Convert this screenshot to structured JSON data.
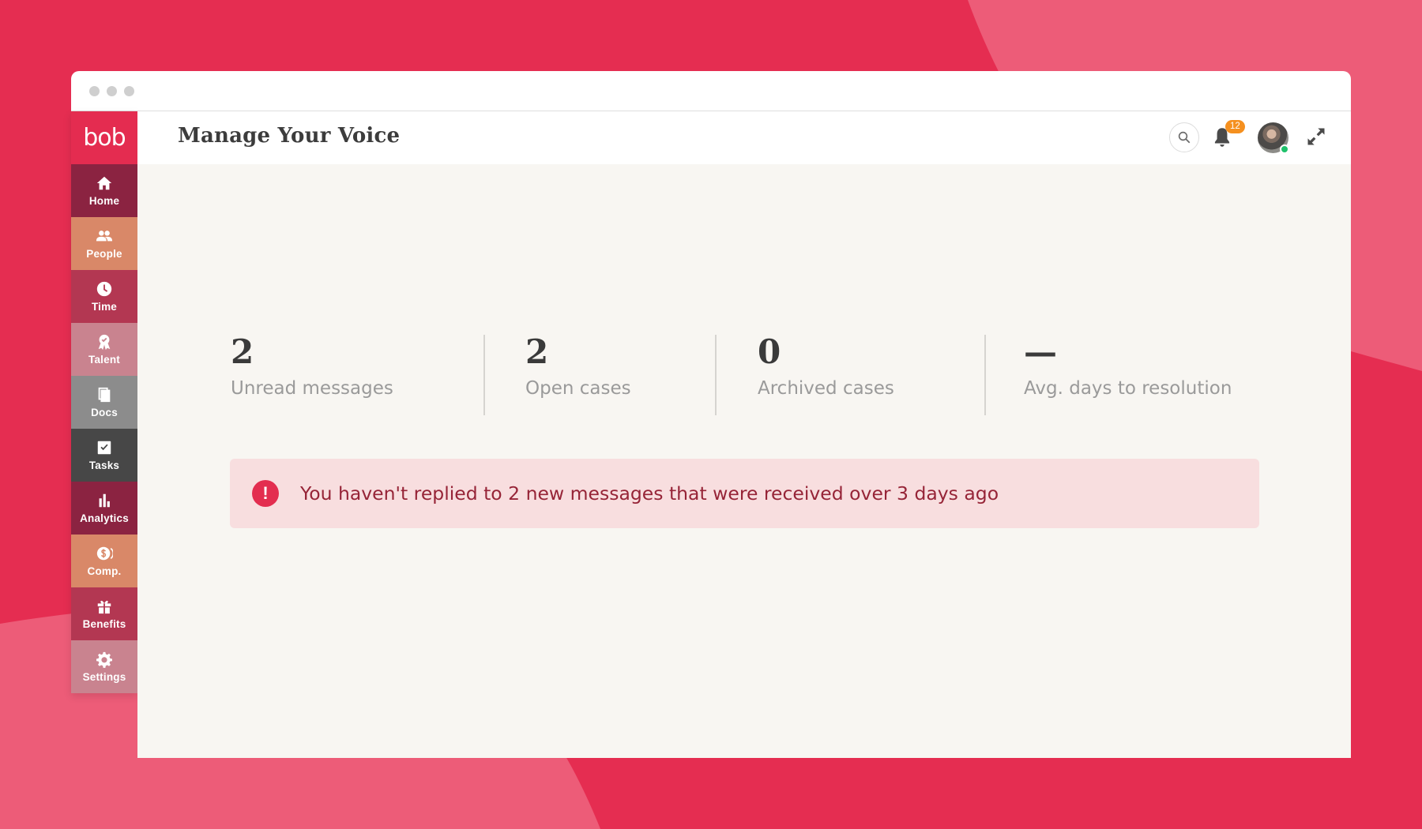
{
  "colors": {
    "background": "#e52d51",
    "background_light": "#ed5c78",
    "alert_bg": "#f8dedf",
    "alert_icon": "#e32d4f",
    "badge": "#f5901f"
  },
  "app": {
    "logo": "bob",
    "page_title": "Manage Your Voice"
  },
  "sidebar": {
    "items": [
      {
        "label": "Home",
        "icon": "home-icon",
        "color": "#8b2341"
      },
      {
        "label": "People",
        "icon": "people-icon",
        "color": "#d98868"
      },
      {
        "label": "Time",
        "icon": "clock-icon",
        "color": "#b33752"
      },
      {
        "label": "Talent",
        "icon": "award-icon",
        "color": "#c9838f"
      },
      {
        "label": "Docs",
        "icon": "documents-icon",
        "color": "#8c8c8c"
      },
      {
        "label": "Tasks",
        "icon": "checkbox-icon",
        "color": "#474747"
      },
      {
        "label": "Analytics",
        "icon": "bar-chart-icon",
        "color": "#8b2341"
      },
      {
        "label": "Comp.",
        "icon": "dollar-coin-icon",
        "color": "#d98868"
      },
      {
        "label": "Benefits",
        "icon": "gift-icon",
        "color": "#b33752"
      },
      {
        "label": "Settings",
        "icon": "gear-icon",
        "color": "#c9838f"
      }
    ]
  },
  "header": {
    "notification_count": "12",
    "search_icon": "search-icon",
    "bell_icon": "bell-icon",
    "expand_icon": "expand-icon"
  },
  "stats": [
    {
      "value": "2",
      "label": "Unread messages"
    },
    {
      "value": "2",
      "label": "Open cases"
    },
    {
      "value": "0",
      "label": "Archived cases"
    },
    {
      "value": "—",
      "label": "Avg. days to resolution"
    }
  ],
  "alert": {
    "icon": "exclamation-icon",
    "symbol": "!",
    "message": "You haven't replied to 2 new messages that were received over 3 days ago"
  }
}
